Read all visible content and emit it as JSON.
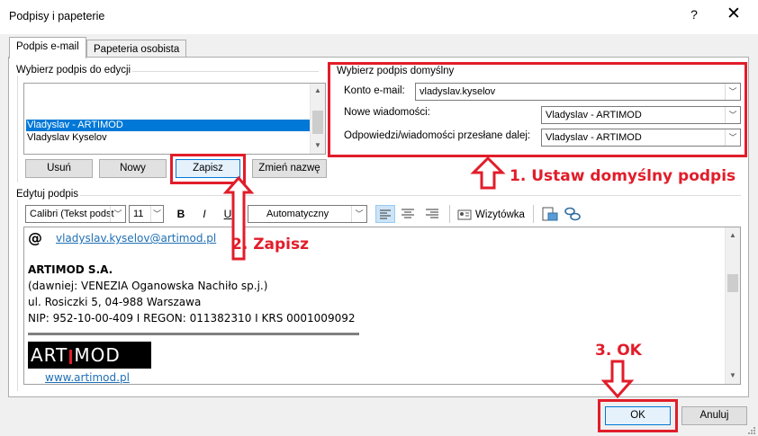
{
  "window": {
    "title": "Podpisy i papeterie",
    "help": "?",
    "close": "✕"
  },
  "tabs": [
    {
      "label": "Podpis e-mail",
      "active": true
    },
    {
      "label": "Papeteria osobista",
      "active": false
    }
  ],
  "select_signature": {
    "label": "Wybierz podpis do edycji",
    "items": [
      "Vladyslav - ARTIMOD",
      "Vladyslav Kyselov"
    ],
    "selected_index": 0
  },
  "buttons": {
    "delete": "Usuń",
    "new": "Nowy",
    "save": "Zapisz",
    "rename": "Zmień nazwę",
    "ok": "OK",
    "cancel": "Anuluj",
    "business_card": "Wizytówka"
  },
  "default_signature": {
    "label": "Wybierz podpis domyślny",
    "account_label": "Konto e-mail:",
    "account_value": "vladyslav.kyselov",
    "new_messages_label": "Nowe wiadomości:",
    "new_messages_value": "Vladyslav - ARTIMOD",
    "replies_label": "Odpowiedzi/wiadomości przesłane dalej:",
    "replies_value": "Vladyslav - ARTIMOD"
  },
  "edit_signature": {
    "label": "Edytuj podpis",
    "font": "Calibri (Tekst podst",
    "size": "11",
    "bold": "B",
    "italic": "I",
    "underline": "U",
    "color": "Automatyczny"
  },
  "signature_content": {
    "at_symbol": "@",
    "email": "vladyslav.kyselov@artimod.pl",
    "company": "ARTIMOD S.A.",
    "former": "(dawniej: VENEZIA Oganowska Nachiło sp.j.)",
    "address": "ul. Rosiczki 5, 04-988 Warszawa",
    "ids": "NIP: 952-10-00-409 I REGON: 011382310 I KRS 0001009092",
    "logo_left": "ART",
    "logo_right": "MOD",
    "website": "www.artimod.pl"
  },
  "annotations": {
    "step1": "1. Ustaw domyślny podpis",
    "step2": "2. Zapisz",
    "step3": "3. OK"
  },
  "colors": {
    "annotation_red": "#e11d2a",
    "selection_blue": "#0078d7",
    "link_blue": "#1f6fb5"
  }
}
